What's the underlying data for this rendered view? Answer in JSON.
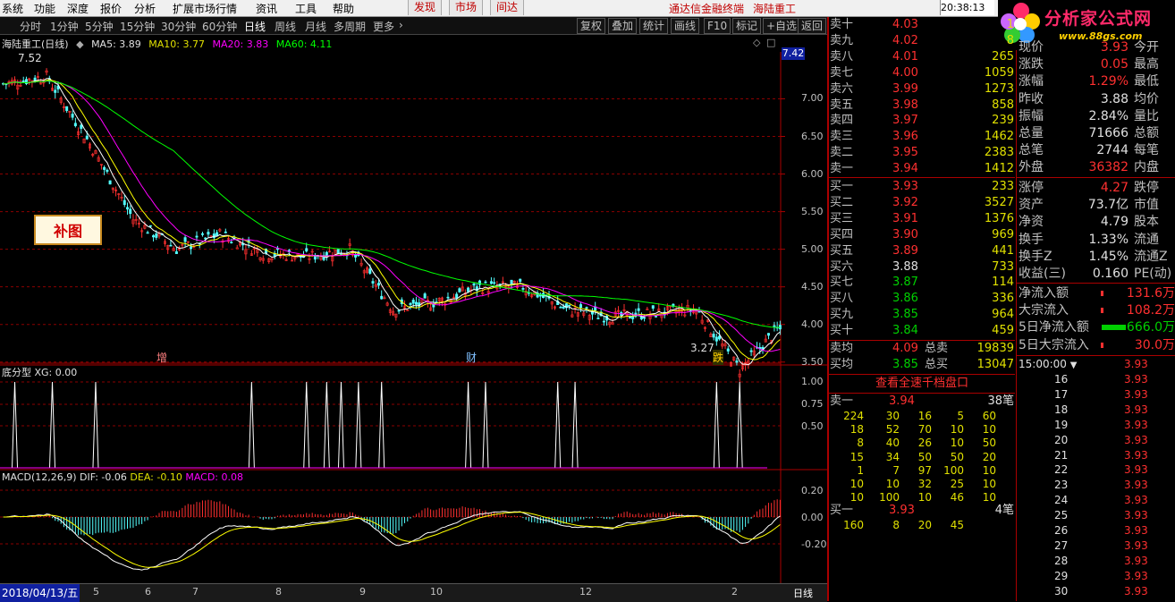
{
  "menu": {
    "items": [
      "系统",
      "功能",
      "深度",
      "报价",
      "分析",
      "扩展市场行情",
      "资讯",
      "工具",
      "帮助"
    ],
    "nav": [
      "发现",
      "市场",
      "间达"
    ],
    "brand": "通达信金融终端",
    "stock_name": "海陆重工",
    "clock": "20:38:13 周"
  },
  "logo": {
    "text": "分析家公式网",
    "url": "www.88gs.com"
  },
  "periods": [
    "分时",
    "1分钟",
    "5分钟",
    "15分钟",
    "30分钟",
    "60分钟",
    "日线",
    "周线",
    "月线",
    "多周期",
    "更多"
  ],
  "active_period": "日线",
  "toolbar": [
    "复权",
    "叠加",
    "统计",
    "画线",
    "F10",
    "标记",
    "+自选",
    "返回"
  ],
  "legend": {
    "title": "海陆重工(日线)",
    "ma5": "MA5: 3.89",
    "ma10": "MA10: 3.77",
    "ma20": "MA20: 3.83",
    "ma60": "MA60: 4.11"
  },
  "colors": {
    "ma5": "#ffffff",
    "ma10": "#ffff00",
    "ma20": "#ff00ff",
    "ma60": "#00ff00",
    "up": "#ff3030",
    "down": "#54ffff",
    "grid": "#8b0000"
  },
  "price_axis": {
    "ticks": [
      "7.00",
      "6.50",
      "6.00",
      "5.50",
      "5.00",
      "4.50",
      "4.00",
      "3.50"
    ],
    "current": "7.42"
  },
  "chart_annotations": {
    "high_label": "7.52",
    "low_label": "3.27",
    "mark_zeng": "增",
    "mark_cai": "财",
    "mark_die": "跌",
    "badge": "补图"
  },
  "indicator1": {
    "title": "底分型",
    "value": "XG: 0.00",
    "ticks": [
      "1.00",
      "0.75",
      "0.50"
    ]
  },
  "indicator2": {
    "title": "MACD(12,26,9)",
    "dif": "DIF: -0.06",
    "dea": "DEA: -0.10",
    "macd": "MACD: 0.08",
    "ticks": [
      "0.20",
      "0.00",
      "-0.20"
    ]
  },
  "bottom": {
    "date": "2018/04/13/五",
    "months": [
      "5",
      "6",
      "7",
      "8",
      "9",
      "10",
      "12",
      "2"
    ],
    "period_label": "日线"
  },
  "order_book": {
    "sell": [
      {
        "label": "卖十",
        "price": "4.03",
        "vol": "1"
      },
      {
        "label": "卖九",
        "price": "4.02",
        "vol": "8"
      },
      {
        "label": "卖八",
        "price": "4.01",
        "vol": "265"
      },
      {
        "label": "卖七",
        "price": "4.00",
        "vol": "1059"
      },
      {
        "label": "卖六",
        "price": "3.99",
        "vol": "1273"
      },
      {
        "label": "卖五",
        "price": "3.98",
        "vol": "858"
      },
      {
        "label": "卖四",
        "price": "3.97",
        "vol": "239"
      },
      {
        "label": "卖三",
        "price": "3.96",
        "vol": "1462"
      },
      {
        "label": "卖二",
        "price": "3.95",
        "vol": "2383"
      },
      {
        "label": "卖一",
        "price": "3.94",
        "vol": "1412"
      }
    ],
    "buy": [
      {
        "label": "买一",
        "price": "3.93",
        "vol": "233"
      },
      {
        "label": "买二",
        "price": "3.92",
        "vol": "3527"
      },
      {
        "label": "买三",
        "price": "3.91",
        "vol": "1376"
      },
      {
        "label": "买四",
        "price": "3.90",
        "vol": "969"
      },
      {
        "label": "买五",
        "price": "3.89",
        "vol": "441"
      },
      {
        "label": "买六",
        "price": "3.88",
        "vol": "733"
      },
      {
        "label": "买七",
        "price": "3.87",
        "vol": "114"
      },
      {
        "label": "买八",
        "price": "3.86",
        "vol": "336"
      },
      {
        "label": "买九",
        "price": "3.85",
        "vol": "964"
      },
      {
        "label": "买十",
        "price": "3.84",
        "vol": "459"
      }
    ],
    "avg_sell": {
      "label": "卖均",
      "price": "4.09",
      "tlabel": "总卖",
      "vol": "19839"
    },
    "avg_buy": {
      "label": "买均",
      "price": "3.85",
      "tlabel": "总买",
      "vol": "13047"
    }
  },
  "fast_book": {
    "button": "查看全速千档盘口",
    "sell1": {
      "label": "卖一",
      "price": "3.94",
      "count": "38笔"
    },
    "sell_grid": [
      [
        "224",
        "30",
        "16",
        "5",
        "60"
      ],
      [
        "18",
        "52",
        "70",
        "10",
        "10"
      ],
      [
        "8",
        "40",
        "26",
        "10",
        "50"
      ],
      [
        "15",
        "34",
        "50",
        "50",
        "20"
      ],
      [
        "1",
        "7",
        "97",
        "100",
        "10"
      ],
      [
        "10",
        "10",
        "32",
        "25",
        "10"
      ],
      [
        "10",
        "100",
        "10",
        "46",
        "10"
      ]
    ],
    "buy1": {
      "label": "买一",
      "price": "3.93",
      "count": "4笔"
    },
    "buy_grid": [
      "160",
      "8",
      "20",
      "45"
    ]
  },
  "stats": [
    {
      "l": "现价",
      "v": "3.93",
      "r": "今开"
    },
    {
      "l": "涨跌",
      "v": "0.05",
      "r": "最高"
    },
    {
      "l": "涨幅",
      "v": "1.29%",
      "r": "最低"
    },
    {
      "l": "昨收",
      "v": "3.88",
      "r": "均价"
    },
    {
      "l": "振幅",
      "v": "2.84%",
      "r": "量比"
    },
    {
      "l": "总量",
      "v": "71666",
      "r": "总额"
    },
    {
      "l": "总笔",
      "v": "2744",
      "r": "每笔"
    },
    {
      "l": "外盘",
      "v": "36382",
      "r": "内盘"
    }
  ],
  "stats2": [
    {
      "l": "涨停",
      "v": "4.27",
      "r": "跌停"
    },
    {
      "l": "资产",
      "v": "73.7亿",
      "r": "市值"
    },
    {
      "l": "净资",
      "v": "4.79",
      "r": "股本"
    },
    {
      "l": "换手",
      "v": "1.33%",
      "r": "流通"
    },
    {
      "l": "换手Z",
      "v": "1.45%",
      "r": "流通Z"
    },
    {
      "l": "收益(三)",
      "v": "0.160",
      "r": "PE(动)"
    }
  ],
  "flows": [
    {
      "l": "净流入额",
      "v": "131.6万"
    },
    {
      "l": "大宗流入",
      "v": "108.2万"
    },
    {
      "l": "5日净流入额",
      "v": "-666.0万"
    },
    {
      "l": "5日大宗流入",
      "v": "30.0万"
    }
  ],
  "ticks_panel": {
    "header_time": "15:00:00",
    "header_price": "3.93",
    "rows": [
      {
        "t": "16",
        "p": "3.93"
      },
      {
        "t": "17",
        "p": "3.93"
      },
      {
        "t": "18",
        "p": "3.93"
      },
      {
        "t": "19",
        "p": "3.93"
      },
      {
        "t": "20",
        "p": "3.93"
      },
      {
        "t": "21",
        "p": "3.93"
      },
      {
        "t": "22",
        "p": "3.93"
      },
      {
        "t": "23",
        "p": "3.93"
      },
      {
        "t": "24",
        "p": "3.93"
      },
      {
        "t": "25",
        "p": "3.93"
      },
      {
        "t": "26",
        "p": "3.93"
      },
      {
        "t": "27",
        "p": "3.93"
      },
      {
        "t": "28",
        "p": "3.93"
      },
      {
        "t": "29",
        "p": "3.93"
      },
      {
        "t": "30",
        "p": "3.93"
      }
    ]
  },
  "chart_data": {
    "type": "candlestick",
    "price_range": [
      3.2,
      7.6
    ],
    "note_points": [
      {
        "i": 0,
        "close": 7.2
      },
      {
        "i": 15,
        "close": 7.3
      },
      {
        "i": 30,
        "close": 6.4
      },
      {
        "i": 45,
        "close": 5.4
      },
      {
        "i": 60,
        "close": 5.0
      },
      {
        "i": 75,
        "close": 5.2
      },
      {
        "i": 90,
        "close": 4.95
      },
      {
        "i": 105,
        "close": 4.9
      },
      {
        "i": 120,
        "close": 5.0
      },
      {
        "i": 135,
        "close": 4.2
      },
      {
        "i": 150,
        "close": 4.3
      },
      {
        "i": 165,
        "close": 4.5
      },
      {
        "i": 180,
        "close": 4.5
      },
      {
        "i": 195,
        "close": 4.2
      },
      {
        "i": 210,
        "close": 4.1
      },
      {
        "i": 225,
        "close": 4.15
      },
      {
        "i": 240,
        "close": 4.2
      },
      {
        "i": 255,
        "close": 3.4
      },
      {
        "i": 268,
        "close": 3.93
      }
    ]
  }
}
